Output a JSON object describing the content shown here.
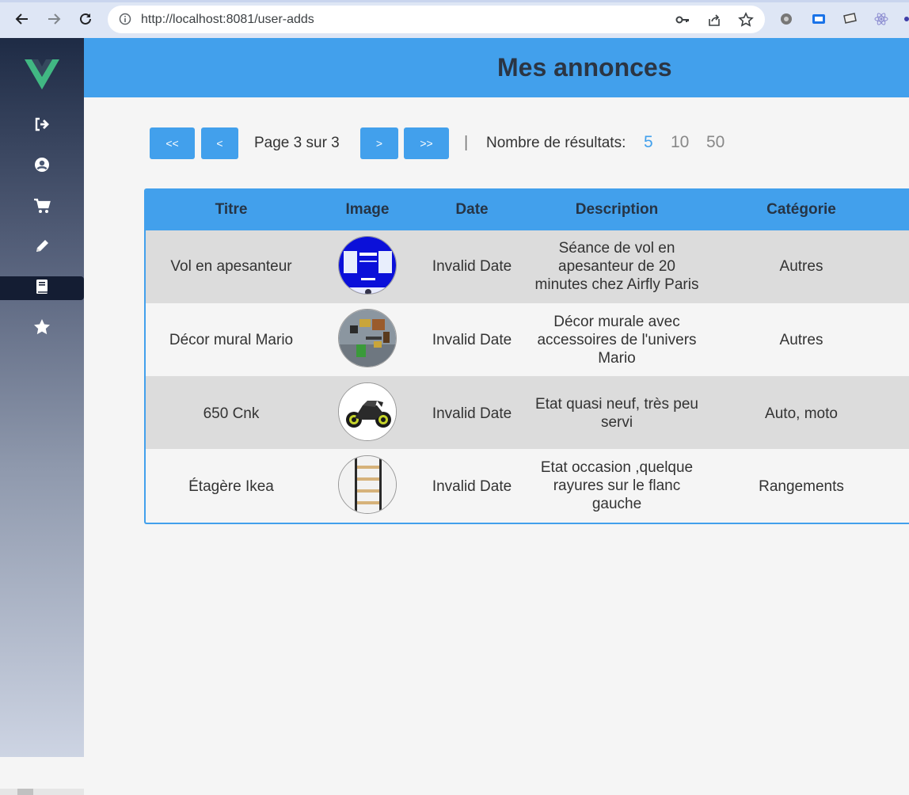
{
  "browser": {
    "url": "http://localhost:8081/user-adds"
  },
  "sidebar": {
    "items": [
      {
        "icon": "logout-icon"
      },
      {
        "icon": "user-icon"
      },
      {
        "icon": "cart-icon"
      },
      {
        "icon": "pencil-icon"
      },
      {
        "icon": "book-icon",
        "active": true
      },
      {
        "icon": "star-icon"
      }
    ]
  },
  "header": {
    "title": "Mes annonces"
  },
  "pagination": {
    "first": "<<",
    "prev": "<",
    "info": "Page 3 sur 3",
    "next": ">",
    "last": ">>",
    "separator": "|",
    "results_label": "Nombre de résultats:",
    "options": [
      "5",
      "10",
      "50"
    ],
    "selected": "5"
  },
  "table": {
    "headers": [
      "Titre",
      "Image",
      "Date",
      "Description",
      "Catégorie"
    ],
    "rows": [
      {
        "title": "Vol en apesanteur",
        "image": "flight-thumbnail",
        "date": "Invalid Date",
        "desc": [
          "Séance de vol en",
          "apesanteur de 20",
          "minutes chez Airfly Paris"
        ],
        "category": "Autres"
      },
      {
        "title": "Décor mural Mario",
        "image": "mario-decor-thumbnail",
        "date": "Invalid Date",
        "desc": [
          "Décor murale avec",
          "accessoires de l'univers",
          "Mario"
        ],
        "category": "Autres"
      },
      {
        "title": "650 Cnk",
        "image": "motorcycle-thumbnail",
        "date": "Invalid Date",
        "desc": [
          "Etat quasi neuf, très peu",
          "servi"
        ],
        "category": "Auto, moto"
      },
      {
        "title": "Étagère Ikea",
        "image": "shelf-thumbnail",
        "date": "Invalid Date",
        "desc": [
          "Etat occasion ,quelque",
          "rayures sur le flanc",
          "gauche"
        ],
        "category": "Rangements"
      }
    ]
  },
  "colors": {
    "accent": "#42a0ec",
    "title": "#2b3543",
    "row_odd": "#dcdcdc",
    "row_even": "#f5f5f5"
  }
}
